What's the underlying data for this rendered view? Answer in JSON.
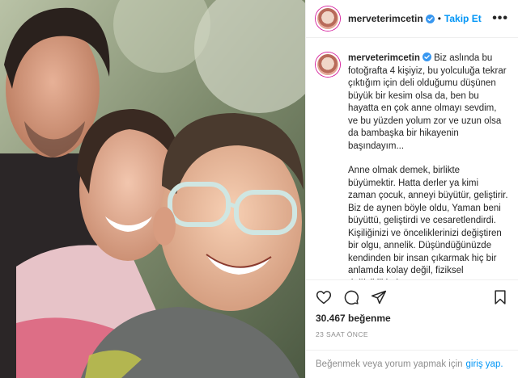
{
  "header": {
    "username": "merveterimcetin",
    "dot": "•",
    "follow_label": "Takip Et",
    "more_label": "•••"
  },
  "caption": {
    "username": "merveterimcetin",
    "paragraph_1": "Biz aslında bu fotoğrafta 4 kişiyiz, bu yolculuğa tekrar çıktığım için deli olduğumu düşünen büyük bir kesim olsa da, ben bu hayatta en çok anne olmayı sevdim, ve bu yüzden yolum zor ve uzun olsa da bambaşka bir hikayenin başındayım...",
    "paragraph_2": "Anne olmak demek, birlikte büyümektir. Hatta derler ya kimi zaman çocuk, anneyi büyütür, geliştirir. Biz de aynen böyle oldu, Yaman beni büyüttü, geliştirdi ve cesaretlendirdi. Kişiliğinizi ve önceliklerinizi değiştiren bir olgu, annelik. Düşündüğünüzde kendinden bir insan çıkarmak hiç bir anlamda kolay değil, fiziksel değişikliklerin"
  },
  "stats": {
    "likes_text": "30.467 beğenme",
    "time_text": "23 SAAT ÖNCE"
  },
  "login": {
    "prompt": "Beğenmek veya yorum yapmak için",
    "link_label": "giriş yap."
  },
  "colors": {
    "accent": "#0095f6",
    "text": "#262626",
    "muted": "#8e8e8e",
    "verified": "#3897f0"
  },
  "icons": {
    "header_verified": "verified-badge-icon",
    "like": "heart-icon",
    "comment": "comment-icon",
    "share": "share-icon",
    "save": "bookmark-icon"
  }
}
